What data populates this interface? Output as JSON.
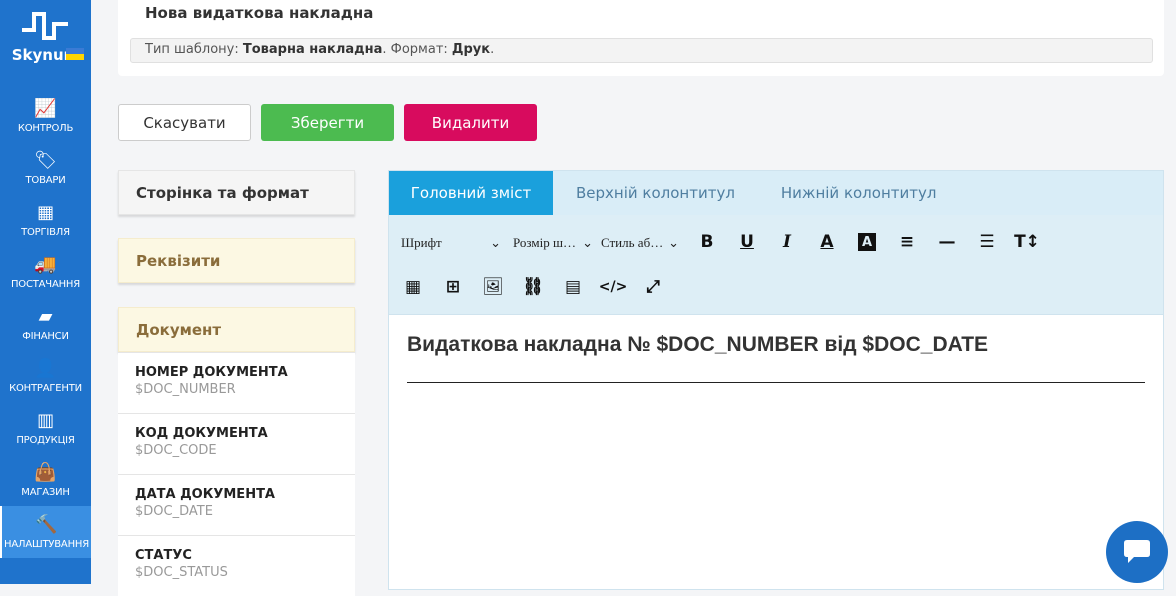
{
  "brand": {
    "name": "Skynum"
  },
  "sidebar": {
    "items": [
      {
        "label": "КОНТРОЛЬ",
        "icon": "chart-growth-icon"
      },
      {
        "label": "ТОВАРИ",
        "icon": "tag-icon"
      },
      {
        "label": "ТОРГІВЛЯ",
        "icon": "cash-register-icon"
      },
      {
        "label": "ПОСТАЧАННЯ",
        "icon": "truck-icon"
      },
      {
        "label": "ФІНАНСИ",
        "icon": "wallet-icon"
      },
      {
        "label": "КОНТРАГЕНТИ",
        "icon": "person-icon"
      },
      {
        "label": "ПРОДУКЦІЯ",
        "icon": "factory-icon"
      },
      {
        "label": "МАГАЗИН",
        "icon": "shop-bag-icon"
      },
      {
        "label": "НАЛАШТУВАННЯ",
        "icon": "settings-hammer-icon",
        "active": true
      }
    ]
  },
  "header": {
    "title": "Нова видаткова накладна",
    "type_label": "Тип шаблону: ",
    "type_value": "Товарна накладна",
    "format_label": ". Формат: ",
    "format_value": "Друк",
    "end": "."
  },
  "actions": {
    "cancel": "Скасувати",
    "save": "Зберегти",
    "delete": "Видалити"
  },
  "left": {
    "page_format": "Сторінка та формат",
    "requisites": "Реквізити",
    "document": "Документ",
    "fields": [
      {
        "name": "НОМЕР ДОКУМЕНТА",
        "var": "$DOC_NUMBER"
      },
      {
        "name": "КОД ДОКУМЕНТА",
        "var": "$DOC_CODE"
      },
      {
        "name": "ДАТА ДОКУМЕНТА",
        "var": "$DOC_DATE"
      },
      {
        "name": "СТАТУС",
        "var": "$DOC_STATUS"
      }
    ]
  },
  "editor": {
    "tabs": [
      "Головний зміст",
      "Верхній колонтитул",
      "Нижній колонтитул"
    ],
    "font": "Шрифт",
    "size": "Розмір ш…",
    "style": "Стиль аб…",
    "heading": "Видаткова накладна № $DOC_NUMBER від $DOC_DATE"
  },
  "colors": {
    "sidebar": "#1f73cc",
    "save": "#4cbb50",
    "delete": "#d80b5e",
    "tab_active": "#1aa0dc"
  }
}
